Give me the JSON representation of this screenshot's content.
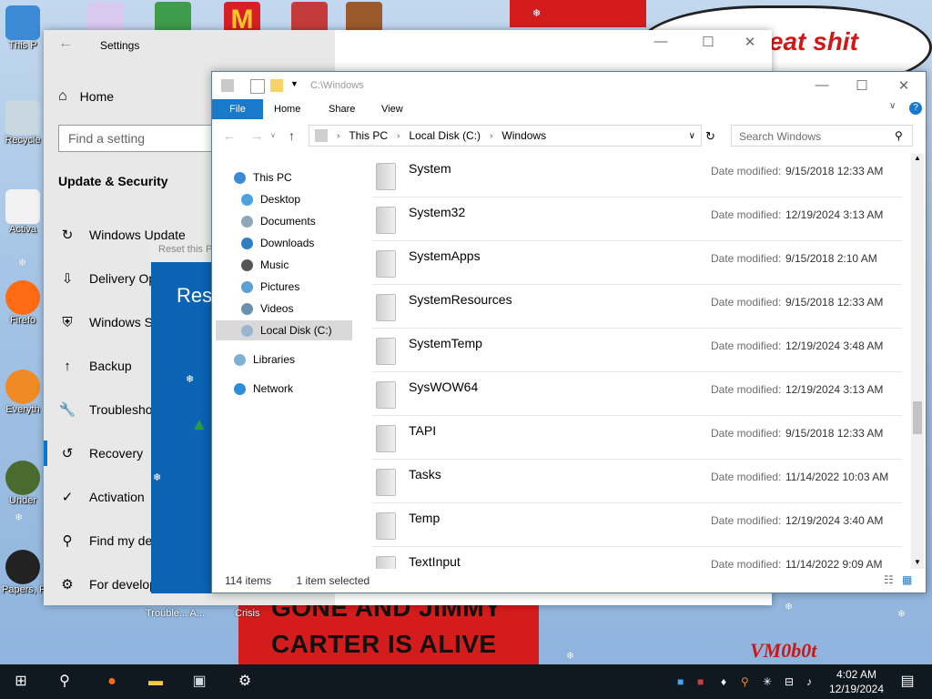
{
  "wallpaper": {
    "speech_text": "o eat shit",
    "banner_line1": "GONE AND JIMMY",
    "banner_line2": "CARTER IS ALIVE",
    "signature": "VM0b0t"
  },
  "desktop_icons": [
    {
      "label": "This P",
      "color": "#3a8ad6"
    },
    {
      "label": "Recycle",
      "color": "#c9d8e0"
    },
    {
      "label": "Activa",
      "color": "#f2f2f2"
    },
    {
      "label": "Firefo",
      "color": "#ff6a13"
    },
    {
      "label": "Everyth",
      "color": "#f08a24"
    },
    {
      "label": "Under",
      "color": "#4a6b2e"
    },
    {
      "label": "Papers, P",
      "color": "#222222"
    }
  ],
  "background_labels": {
    "trouble": "Trouble... A...",
    "crisis": "Crisis"
  },
  "settings": {
    "title": "Settings",
    "home": "Home",
    "find_placeholder": "Find a setting",
    "section": "Update & Security",
    "nav": [
      {
        "label": "Windows Update",
        "icon": "↻"
      },
      {
        "label": "Delivery Op",
        "icon": "⇩"
      },
      {
        "label": "Windows Se",
        "icon": "⛨"
      },
      {
        "label": "Backup",
        "icon": "↑"
      },
      {
        "label": "Troublesho",
        "icon": "🔧"
      },
      {
        "label": "Recovery",
        "icon": "↺"
      },
      {
        "label": "Activation",
        "icon": "✓"
      },
      {
        "label": "Find my de",
        "icon": "⚲"
      },
      {
        "label": "For develop",
        "icon": "⚙"
      }
    ]
  },
  "reset_dialog": {
    "bar": "Reset this P",
    "title": "Res"
  },
  "explorer": {
    "title_path": "C:\\Windows",
    "ribbon_tabs": [
      "File",
      "Home",
      "Share",
      "View"
    ],
    "breadcrumb": [
      "This PC",
      "Local Disk (C:)",
      "Windows"
    ],
    "search_placeholder": "Search Windows",
    "nav_pane": [
      {
        "label": "This PC",
        "color": "#3a8ad6",
        "indent": 0
      },
      {
        "label": "Desktop",
        "color": "#4aa3e0",
        "indent": 1
      },
      {
        "label": "Documents",
        "color": "#8fa7b8",
        "indent": 1
      },
      {
        "label": "Downloads",
        "color": "#2f7fc4",
        "indent": 1
      },
      {
        "label": "Music",
        "color": "#555555",
        "indent": 1
      },
      {
        "label": "Pictures",
        "color": "#5b9fd4",
        "indent": 1
      },
      {
        "label": "Videos",
        "color": "#6c8fb0",
        "indent": 1
      },
      {
        "label": "Local Disk (C:)",
        "color": "#9ab5cc",
        "indent": 1,
        "selected": true
      },
      {
        "label": "Libraries",
        "color": "#7fb0d6",
        "indent": 0
      },
      {
        "label": "Network",
        "color": "#2a8fd8",
        "indent": 0
      }
    ],
    "date_label": "Date modified:",
    "files": [
      {
        "name": "System",
        "date": "9/15/2018 12:33 AM"
      },
      {
        "name": "System32",
        "date": "12/19/2024 3:13 AM"
      },
      {
        "name": "SystemApps",
        "date": "9/15/2018 2:10 AM"
      },
      {
        "name": "SystemResources",
        "date": "9/15/2018 12:33 AM"
      },
      {
        "name": "SystemTemp",
        "date": "12/19/2024 3:48 AM"
      },
      {
        "name": "SysWOW64",
        "date": "12/19/2024 3:13 AM"
      },
      {
        "name": "TAPI",
        "date": "9/15/2018 12:33 AM"
      },
      {
        "name": "Tasks",
        "date": "11/14/2022 10:03 AM"
      },
      {
        "name": "Temp",
        "date": "12/19/2024 3:40 AM"
      },
      {
        "name": "TextInput",
        "date": "11/14/2022 9:09 AM"
      }
    ],
    "status_items": "114 items",
    "status_selected": "1 item selected"
  },
  "taskbar": {
    "time": "4:02 AM",
    "date": "12/19/2024"
  }
}
